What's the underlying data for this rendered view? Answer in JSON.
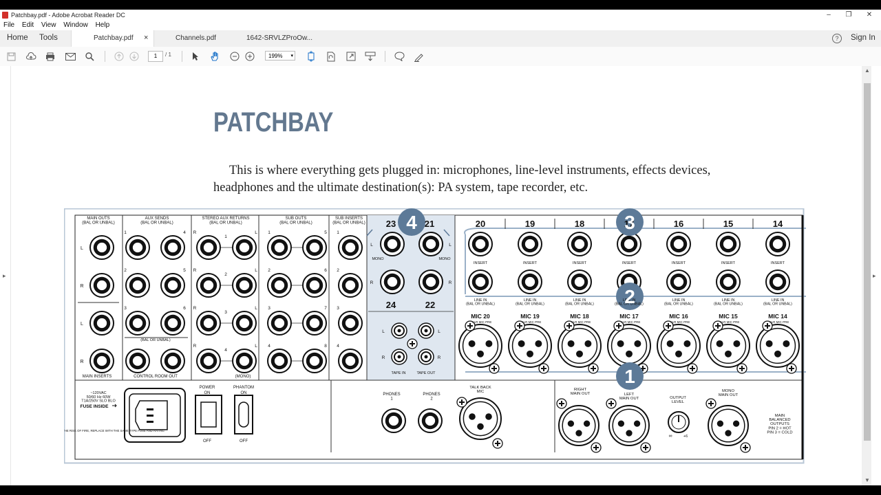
{
  "window": {
    "title": "Patchbay.pdf - Adobe Acrobat Reader DC",
    "min": "–",
    "restore": "❐",
    "close": "✕"
  },
  "menu": [
    "File",
    "Edit",
    "View",
    "Window",
    "Help"
  ],
  "tabs": {
    "home": "Home",
    "tools": "Tools",
    "docs": [
      {
        "label": "Patchbay.pdf",
        "close": "×"
      },
      {
        "label": "Channels.pdf"
      },
      {
        "label": "1642-SRVLZProOw..."
      }
    ],
    "help": "?",
    "signin": "Sign In"
  },
  "toolbar": {
    "page_current": "1",
    "page_total": "/ 1",
    "zoom": "199%"
  },
  "document": {
    "heading": "PATCHBAY",
    "para_line1": "This is where everything gets plugged in: microphones, line-level instruments, effects devices,",
    "para_line2": "headphones and the ultimate destination(s): PA system, tape recorder, etc."
  },
  "diagram": {
    "badges": [
      "4",
      "3",
      "2",
      "1"
    ],
    "section_headers": {
      "main_outs": "MAIN OUTS\n(BAL OR UNBAL)",
      "aux_sends": "AUX SENDS\n(BAL OR UNBAL)",
      "stereo_aux_returns": "STEREO AUX RETURNS\n(BAL OR UNBAL)",
      "sub_outs": "SUB OUTS\n(BAL OR UNBAL)",
      "sub_inserts": "SUB INSERTS\n(BAL OR UNBAL)"
    },
    "bottom_labels": {
      "main_inserts": "MAIN INSERTS",
      "control_room_out": "CONTROL ROOM OUT",
      "bal_or_unbal": "(BAL OR UNBAL)",
      "mono": "(MONO)",
      "tape_in": "TAPE IN",
      "tape_out": "TAPE OUT",
      "mono_l": "MONO",
      "mono_r": "MONO"
    },
    "channel_numbers": [
      "20",
      "19",
      "18",
      "17",
      "16",
      "15",
      "14"
    ],
    "tape_channels_top": [
      "23",
      "21"
    ],
    "tape_channels_bottom": [
      "24",
      "22"
    ],
    "insert_label": "INSERT",
    "line_in_label": "LINE IN\n(BAL OR UNBAL)",
    "mic_labels": [
      "MIC 20",
      "MIC 19",
      "MIC 18",
      "MIC 17",
      "MIC 16",
      "MIC 15",
      "MIC 14"
    ],
    "xlr_sub": "XLR MIC PRE",
    "power_spec": "~120VAC\n50/60 Hz 60W\nT1A/250V SLO BLO",
    "fuse_inside": "FUSE INSIDE",
    "caution": "CAUTION: TO REDUCE THE RISK OF FIRE, REPLACE WITH THE SAME TYPE FUSE AND RATING",
    "power": {
      "label": "POWER",
      "on": "ON",
      "off": "OFF"
    },
    "phantom": {
      "label": "PHANTOM",
      "on": "ON",
      "off": "OFF"
    },
    "phones": [
      "PHONES\n1",
      "PHONES\n2"
    ],
    "talkback": "TALK BACK\nMIC",
    "right_main_out": "RIGHT\nMAIN OUT",
    "left_main_out": "LEFT\nMAIN OUT",
    "output_level": "OUTPUT\nLEVEL",
    "mono_main_out": "MONO\nMAIN OUT",
    "main_balanced": "MAIN\nBALANCED\nOUTPUTS\nPIN 2 = HOT\nPIN 3 = COLD",
    "knob_min": "∞",
    "knob_max": "+6",
    "row_letters": {
      "L": "L",
      "R": "R"
    },
    "pair_numbers": [
      "1",
      "2",
      "3",
      "4",
      "5",
      "6"
    ]
  }
}
